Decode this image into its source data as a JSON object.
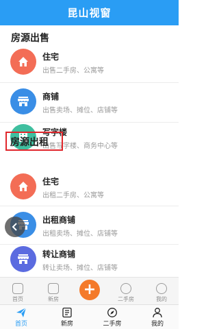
{
  "app": {
    "title": "昆山视窗"
  },
  "sale": {
    "title": "房源出售",
    "items": [
      {
        "title": "住宅",
        "sub": "出售二手房、公寓等"
      },
      {
        "title": "商铺",
        "sub": "出售卖场、摊位、店铺等"
      },
      {
        "title": "写字楼",
        "sub": "出售写字楼、商务中心等"
      }
    ]
  },
  "rent": {
    "title": "房源出租",
    "items": [
      {
        "title": "住宅",
        "sub": "出租二手房、公寓等"
      },
      {
        "title": "出租商铺",
        "sub": "出租卖场、摊位、店铺等"
      },
      {
        "title": "转让商铺",
        "sub": "转让卖场、摊位、店铺等"
      }
    ]
  },
  "ghost_nav": [
    "首页",
    "新房",
    "二手房",
    "我的"
  ],
  "tabs": [
    {
      "label": "首页",
      "icon": "send-icon",
      "active": true
    },
    {
      "label": "新房",
      "icon": "news-icon"
    },
    {
      "label": "二手房",
      "icon": "compass-icon"
    },
    {
      "label": "我的",
      "icon": "user-icon"
    }
  ],
  "colors": {
    "brand": "#2a9df4",
    "accent": "#f47a2a",
    "highlight": "#e0262b"
  }
}
